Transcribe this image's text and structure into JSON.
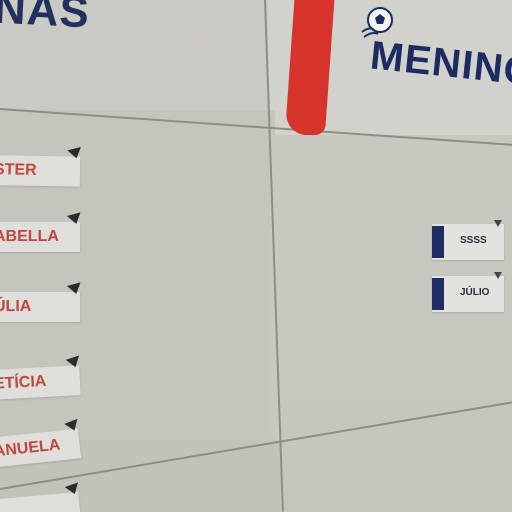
{
  "banners": {
    "girls_title": "NAS",
    "boys_title": "MENINO"
  },
  "icons": {
    "heart": "heart-icon",
    "soccer_ball": "soccer-ball-icon"
  },
  "name_cards": [
    {
      "label": "STER"
    },
    {
      "label": "ABELLA"
    },
    {
      "label": "ÚLIA"
    },
    {
      "label": "ETÍCIA"
    },
    {
      "label": "ANUELA"
    },
    {
      "label": ""
    }
  ],
  "tags": [
    {
      "label": "SSSS"
    },
    {
      "label": "JÚLIO"
    }
  ],
  "colors": {
    "banner_text": "#1d2b62",
    "ribbon": "#d6342a",
    "name_text": "#c2463f",
    "tag_bar": "#1f2d66"
  }
}
